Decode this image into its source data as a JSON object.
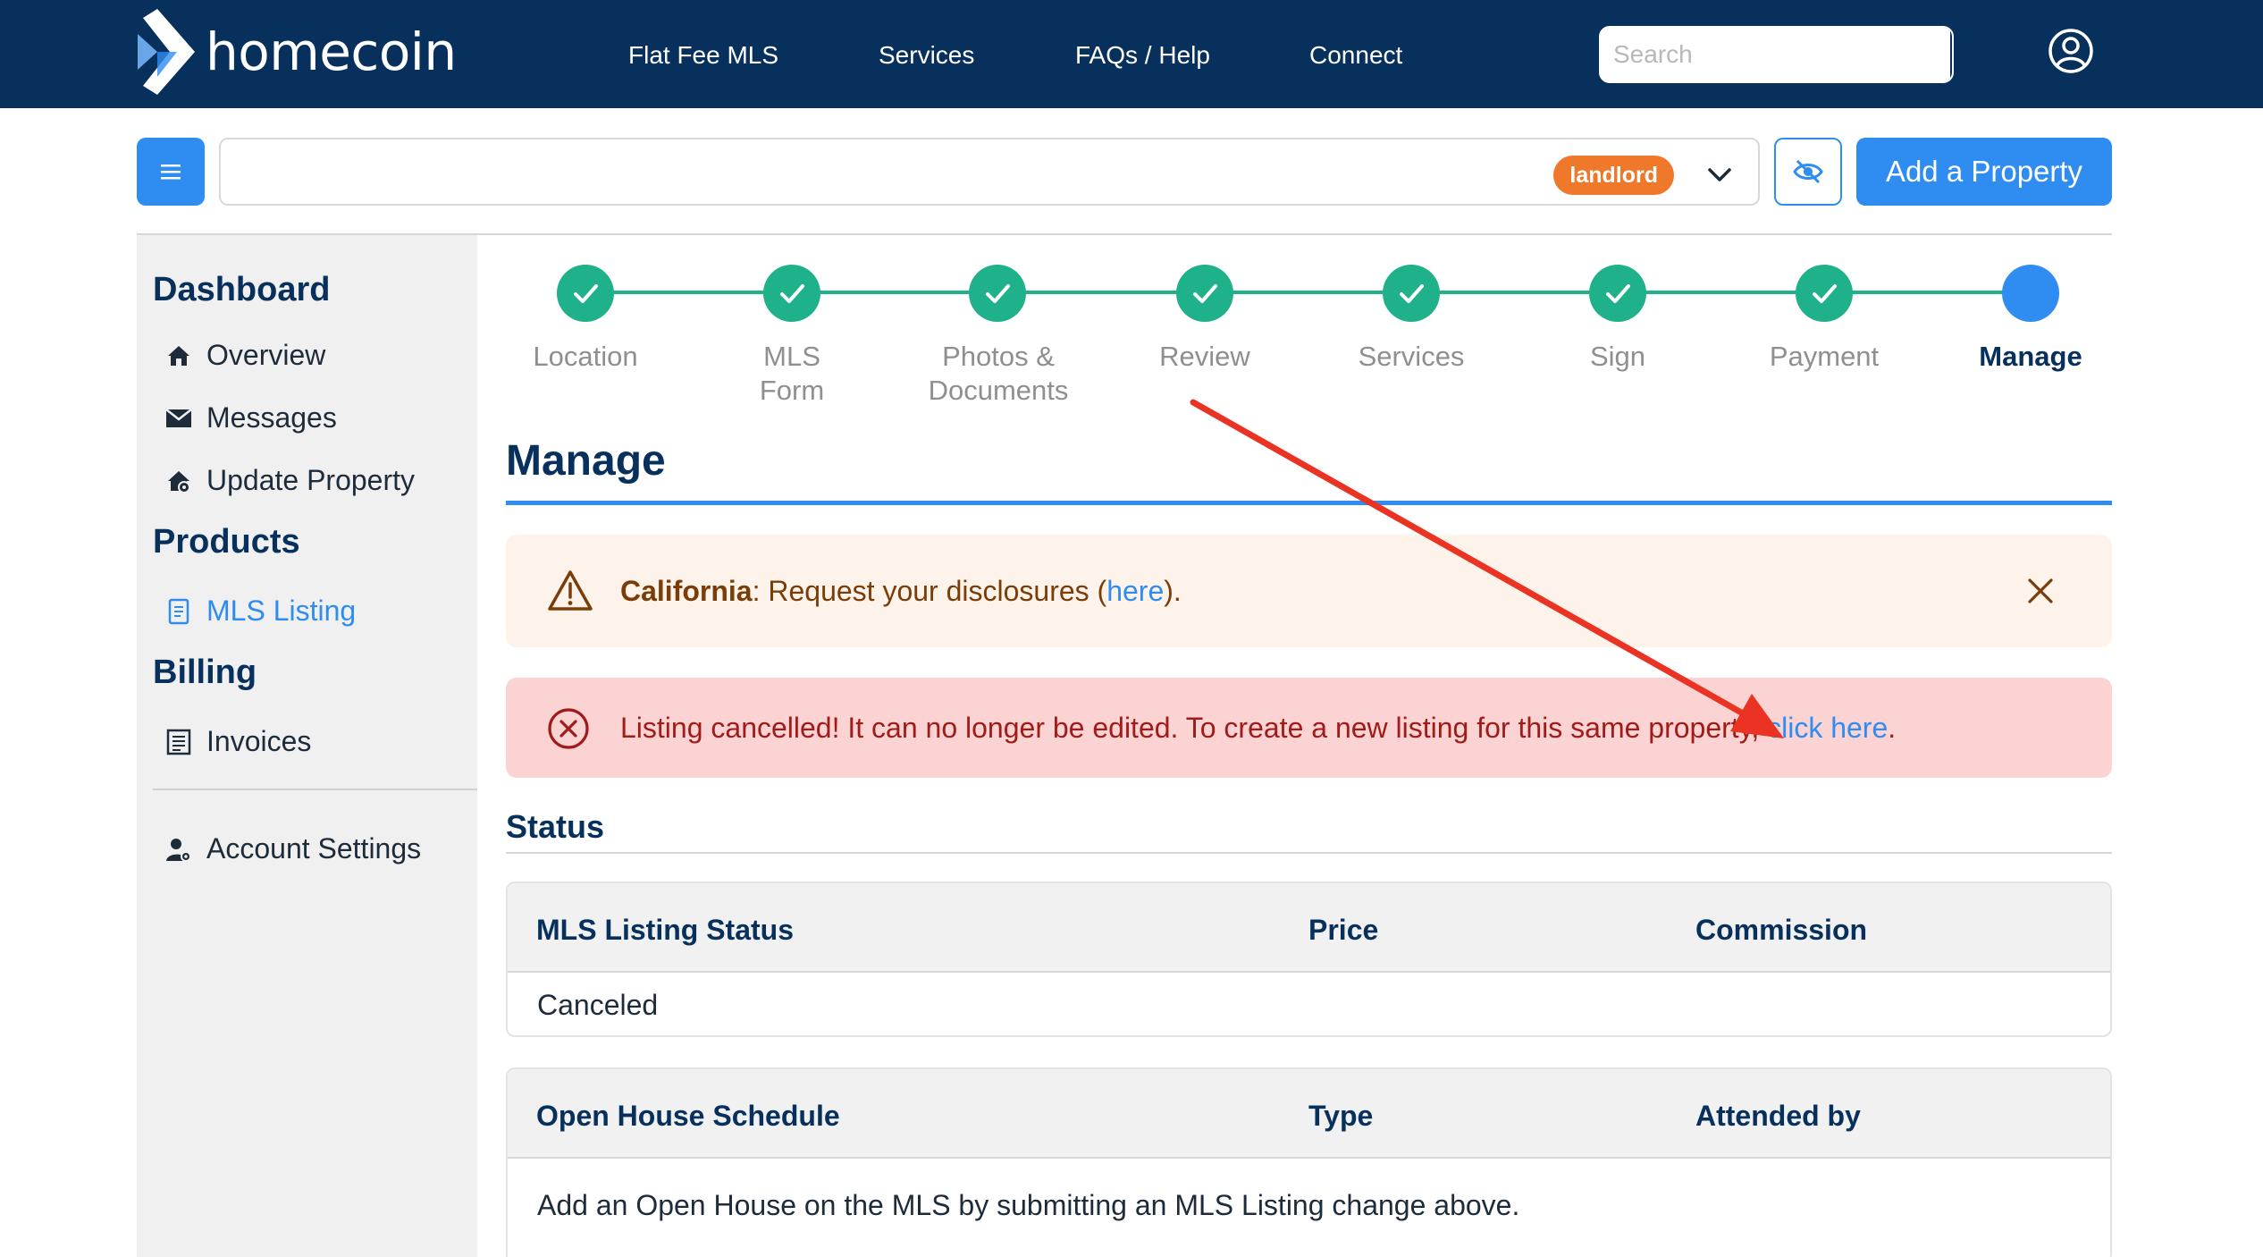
{
  "brand": {
    "name": "homecoin"
  },
  "nav": {
    "links": [
      "Flat Fee MLS",
      "Services",
      "FAQs / Help",
      "Connect"
    ],
    "search_placeholder": "Search"
  },
  "toolbar": {
    "badge": "landlord",
    "add_property_label": "Add a Property"
  },
  "sidebar": {
    "dashboard_heading": "Dashboard",
    "dashboard_items": [
      "Overview",
      "Messages",
      "Update Property"
    ],
    "products_heading": "Products",
    "products_items": [
      "MLS Listing"
    ],
    "billing_heading": "Billing",
    "billing_items": [
      "Invoices"
    ],
    "account_settings": "Account Settings"
  },
  "stepper": {
    "steps": [
      {
        "label_1": "Location",
        "label_2": "",
        "status": "complete"
      },
      {
        "label_1": "MLS",
        "label_2": "Form",
        "status": "complete"
      },
      {
        "label_1": "Photos &",
        "label_2": "Documents",
        "status": "complete"
      },
      {
        "label_1": "Review",
        "label_2": "",
        "status": "complete"
      },
      {
        "label_1": "Services",
        "label_2": "",
        "status": "complete"
      },
      {
        "label_1": "Sign",
        "label_2": "",
        "status": "complete"
      },
      {
        "label_1": "Payment",
        "label_2": "",
        "status": "complete"
      },
      {
        "label_1": "Manage",
        "label_2": "",
        "status": "current"
      }
    ]
  },
  "page": {
    "title": "Manage"
  },
  "alerts": {
    "warning": {
      "bold": "California",
      "text_before": ": Request your disclosures (",
      "link": "here",
      "text_after": ")."
    },
    "error": {
      "text": "Listing cancelled! It can no longer be edited. To create a new listing for this same property, ",
      "link": "click here",
      "text_after": "."
    }
  },
  "status": {
    "heading": "Status",
    "table": {
      "headers": [
        "MLS Listing Status",
        "Price",
        "Commission"
      ],
      "rows": [
        [
          "Canceled",
          "",
          ""
        ]
      ]
    }
  },
  "open_house": {
    "headers": [
      "Open House Schedule",
      "Type",
      "Attended by"
    ],
    "message": "Add an Open House on the MLS by submitting an MLS Listing change above."
  },
  "colors": {
    "navbar": "#07305c",
    "accent": "#2f8cf0",
    "step_complete": "#1fb18a",
    "badge": "#f0782a",
    "error_bg": "#fbd3d3",
    "warning_bg": "#fdf3ea",
    "annotation_arrow": "#ea3323"
  }
}
